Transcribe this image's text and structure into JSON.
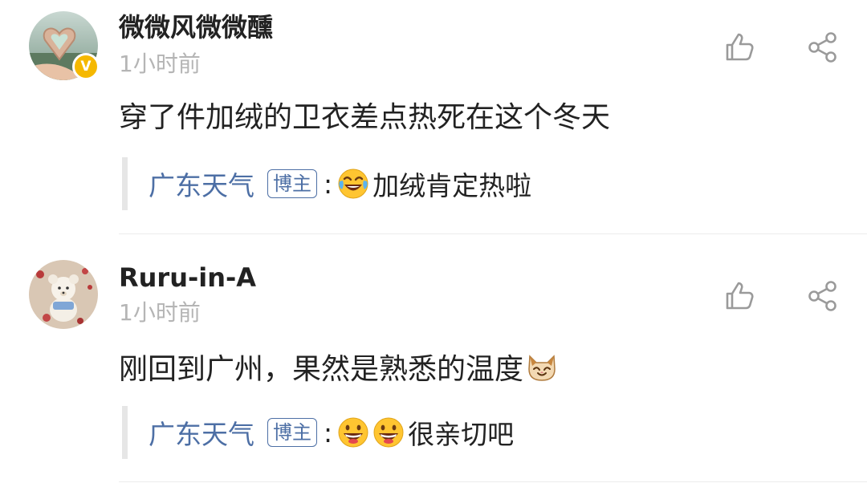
{
  "comments": [
    {
      "username": "微微风微微醺",
      "time": "1小时前",
      "verified": true,
      "verified_mark": "V",
      "avatar_icon": "heart-hands-avatar",
      "text": "穿了件加绒的卫衣差点热死在这个冬天",
      "reply": {
        "name": "广东天气",
        "badge": "博主",
        "colon": ":",
        "emojis": [
          "laugh-cry-emoji"
        ],
        "text": "加绒肯定热啦"
      }
    },
    {
      "username": "Ruru-in-A",
      "time": "1小时前",
      "verified": false,
      "avatar_icon": "teddy-bear-avatar",
      "text": "刚回到广州，果然是熟悉的温度",
      "text_emoji": "cat-emoji",
      "reply": {
        "name": "广东天气",
        "badge": "博主",
        "colon": ":",
        "emojis": [
          "grin-emoji",
          "grin-emoji"
        ],
        "text": "很亲切吧"
      }
    }
  ],
  "icons": {
    "like": "thumbs-up-icon",
    "share": "share-icon"
  },
  "colors": {
    "link_blue": "#4d6fa5",
    "verified_gold": "#f5b800",
    "timestamp_gray": "#b5b5b5"
  }
}
